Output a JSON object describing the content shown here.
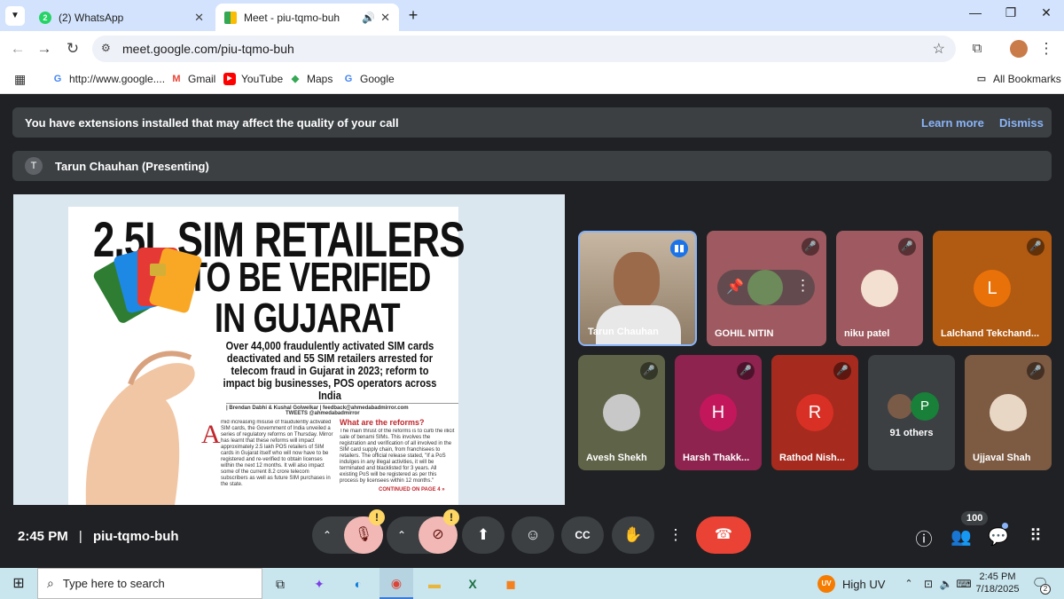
{
  "browser": {
    "tabs": [
      {
        "label": "(2) WhatsApp",
        "badge": "2"
      },
      {
        "label": "Meet - piu-tqmo-buh"
      }
    ],
    "url": "meet.google.com/piu-tqmo-buh",
    "bookmarks": [
      {
        "label": "http://www.google...."
      },
      {
        "label": "Gmail"
      },
      {
        "label": "YouTube"
      },
      {
        "label": "Maps"
      },
      {
        "label": "Google"
      }
    ],
    "all_bookmarks": "All Bookmarks"
  },
  "meet": {
    "extension_banner": {
      "message": "You have extensions installed that may affect the quality of your call",
      "learn_more": "Learn more",
      "dismiss": "Dismiss"
    },
    "presenter": {
      "initial": "T",
      "label": "Tarun Chauhan (Presenting)"
    },
    "presentation": {
      "headline": [
        "2.5L SIM RETAILERS",
        "TO BE VERIFIED",
        "IN GUJARAT"
      ],
      "subhead": "Over 44,000 fraudulently activated SIM cards deactivated and 55 SIM retailers arrested for telecom fraud in Gujarat in 2023; reform to impact big businesses, POS operators across India",
      "byline": "| Brendan Dabhi & Kushal Golwelkar | feedback@ahmedabadmirror.com",
      "tweets": "TWEETS @ahmedabadmirror",
      "sidebar_title": "What are the reforms?",
      "body_left": "mid increasing misuse of fraudulently activated SIM cards, the Government of India unveiled a series of regulatory reforms on Thursday. Mirror has learnt that these reforms will impact approximately 2.5 lakh POS retailers of SIM cards in Gujarat itself who will now have to be registered and re-verified to obtain licenses within the next 12 months. It will also impact some of the current 8.2 crore telecom subscribers as well as future SIM purchases in the state.",
      "body_right": "The main thrust of the reforms is to curb the illicit sale of benami SIMs. This involves the registration and verification of all involved in the SIM card supply chain, from franchisees to retailers. The official release stated, \"If a PoS indulges in any illegal activities, it will be terminated and blacklisted for 3 years. All existing PoS will be registered as per this process by licensees within 12 months.\"",
      "continued": "CONTINUED ON PAGE 4 »"
    },
    "participants": [
      {
        "name": "Tarun Chauhan",
        "type": "video",
        "speaking": true
      },
      {
        "name": "GOHIL NITIN",
        "type": "photo"
      },
      {
        "name": "niku patel",
        "type": "photo"
      },
      {
        "name": "Lalchand Tekchand...",
        "initial": "L",
        "color": "#e8710a"
      },
      {
        "name": "Avesh Shekh",
        "type": "photo"
      },
      {
        "name": "Harsh Thakk...",
        "initial": "H",
        "color": "#c2185b"
      },
      {
        "name": "Rathod Nish...",
        "initial": "R",
        "color": "#d93025"
      },
      {
        "name": "Ujjaval Shah",
        "type": "photo"
      }
    ],
    "others": {
      "label": "91 others",
      "initial": "P"
    },
    "bottom": {
      "time": "2:45 PM",
      "separator": "|",
      "meeting_code": "piu-tqmo-buh",
      "people_count": "100",
      "warn_mark": "!"
    }
  },
  "taskbar": {
    "search_placeholder": "Type here to search",
    "weather": "High UV",
    "weather_badge": "UV",
    "time": "2:45 PM",
    "date": "7/18/2025",
    "notif_count": "2"
  },
  "colors": {
    "accent_blue": "#8ab4f8",
    "end_call": "#ea4335",
    "mute_bg": "#f2b8b5"
  }
}
